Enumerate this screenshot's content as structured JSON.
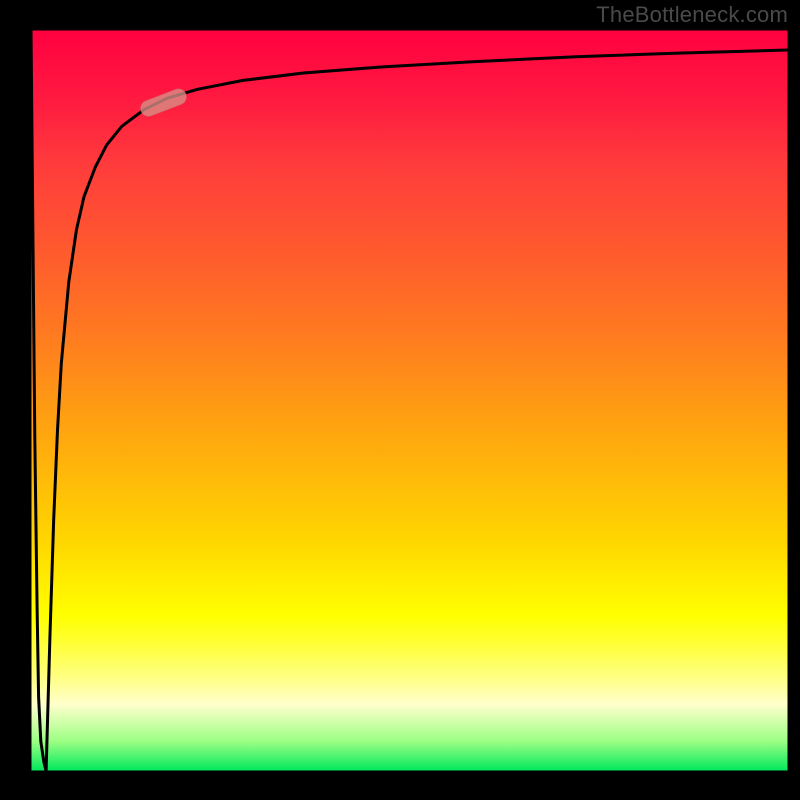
{
  "watermark": "TheBottleneck.com",
  "colors": {
    "gradient_top": "#ff0040",
    "gradient_mid": "#ffd600",
    "gradient_bottom": "#00e85c",
    "curve": "#000000",
    "marker_fill": "#d98f87",
    "marker_stroke": "#b97066",
    "frame": "#000000"
  },
  "chart_data": {
    "type": "line",
    "title": "",
    "xlabel": "",
    "ylabel": "",
    "xlim": [
      0,
      100
    ],
    "ylim": [
      0,
      100
    ],
    "grid": false,
    "legend": false,
    "x": [
      0,
      0.5,
      0.8,
      1.0,
      1.3,
      1.7,
      2,
      2.5,
      3,
      3.5,
      4,
      5,
      6,
      7,
      8.5,
      10,
      12,
      15,
      18,
      22,
      28,
      36,
      46,
      58,
      72,
      86,
      100
    ],
    "values": [
      100,
      45,
      22,
      10,
      4,
      1.2,
      0,
      18,
      34,
      46,
      55,
      66,
      73,
      77.5,
      81.5,
      84.5,
      87,
      89.3,
      90.8,
      92,
      93.2,
      94.2,
      95,
      95.7,
      96.4,
      96.9,
      97.3
    ],
    "marker": {
      "x": 17.5,
      "y": 90.2,
      "angle_deg": -21
    }
  }
}
